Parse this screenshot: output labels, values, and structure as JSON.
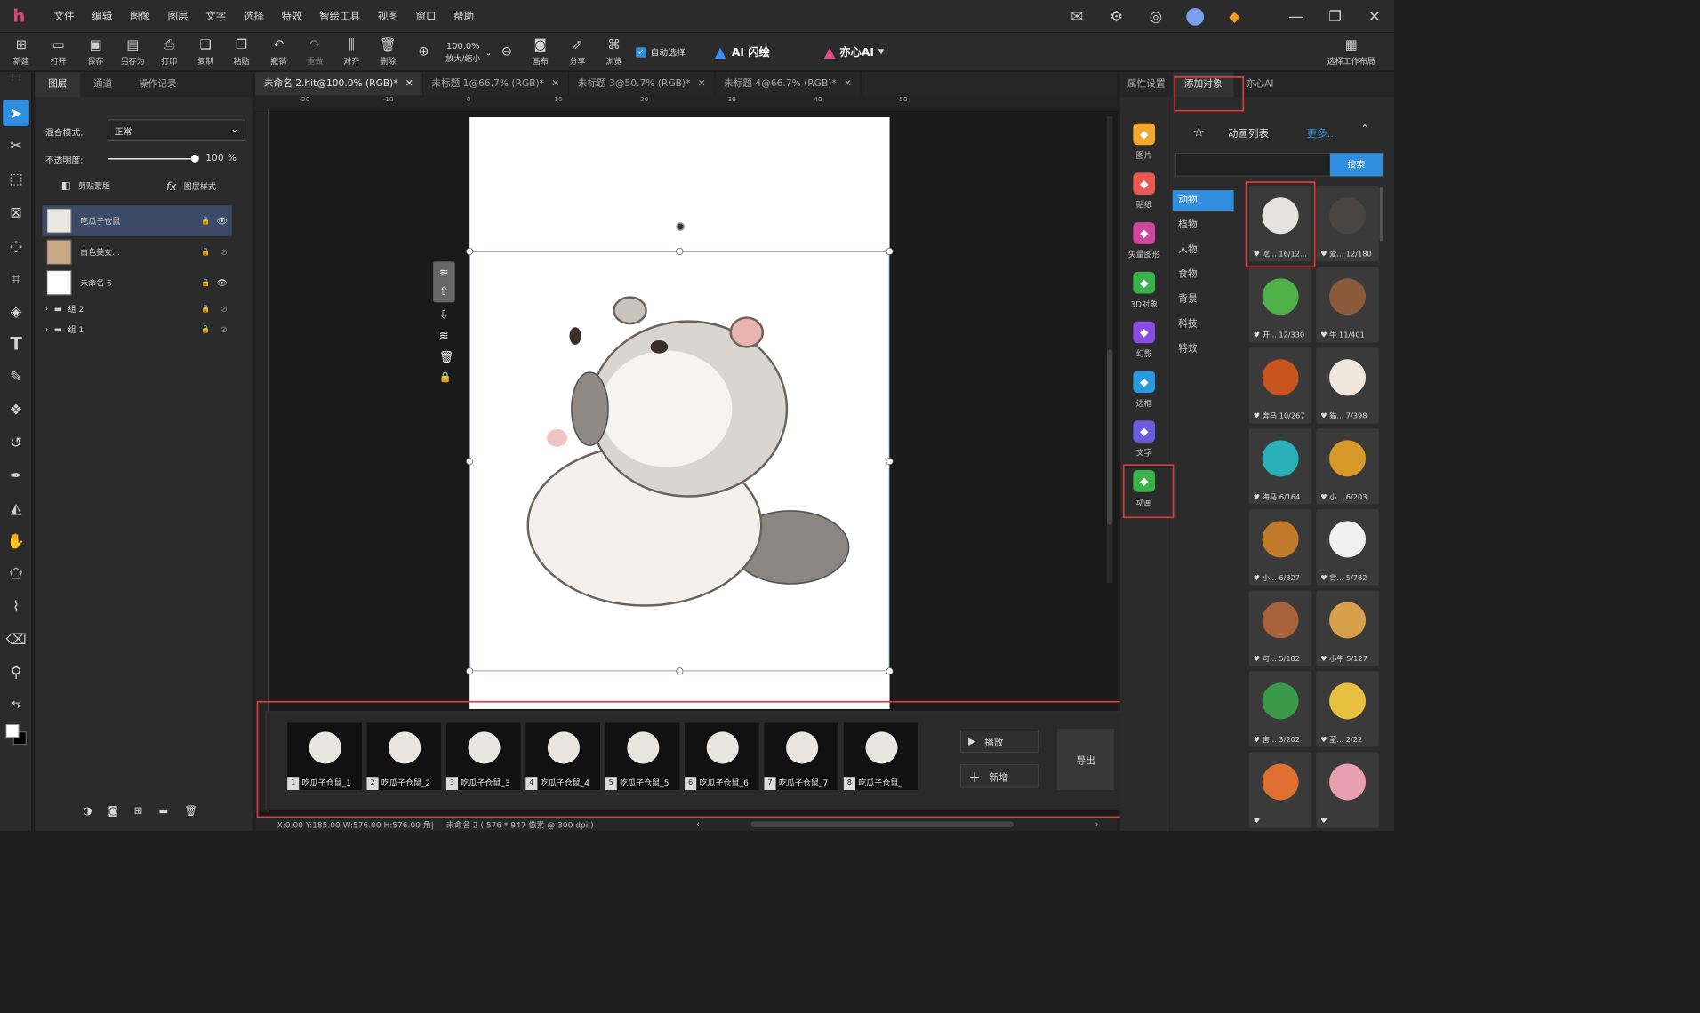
{
  "menubar": {
    "logo": "h",
    "items": [
      "文件",
      "编辑",
      "图像",
      "图层",
      "文字",
      "选择",
      "特效",
      "智绘工具",
      "视图",
      "窗口",
      "帮助"
    ]
  },
  "toolbar": {
    "new": "新建",
    "open": "打开",
    "save": "保存",
    "save_as": "另存为",
    "print": "打印",
    "copy": "复制",
    "paste": "粘贴",
    "undo": "撤销",
    "redo": "重做",
    "align": "对齐",
    "delete": "删除",
    "zoom_value": "100.0%",
    "zoom_label": "放大/缩小",
    "canvas": "画布",
    "share": "分享",
    "browse": "浏览",
    "auto_select": "自动选择",
    "ai_flash": "AI 闪绘",
    "yixin_ai": "亦心AI",
    "workspace": "选择工作布局"
  },
  "layers_panel": {
    "tabs": [
      "图层",
      "通道",
      "操作记录"
    ],
    "blend_label": "混合模式:",
    "blend_value": "正常",
    "opacity_label": "不透明度:",
    "opacity_value": "100",
    "opacity_unit": "%",
    "opacity_fraction": 1.0,
    "clip_mask": "剪贴蒙版",
    "layer_style": "图层样式",
    "layers": [
      {
        "name": "吃瓜子仓鼠",
        "selected": true
      },
      {
        "name": "白色美女...",
        "selected": false
      },
      {
        "name": "未命名 6",
        "selected": false
      }
    ],
    "groups": [
      "组 2",
      "组 1"
    ]
  },
  "doc_tabs": [
    {
      "label": "未命名 2.hit@100.0% (RGB)*",
      "active": true
    },
    {
      "label": "未标题 1@66.7% (RGB)*",
      "active": false
    },
    {
      "label": "未标题 3@50.7% (RGB)*",
      "active": false
    },
    {
      "label": "未标题 4@66.7% (RGB)*",
      "active": false
    }
  ],
  "ruler": {
    "h_ticks": [
      "-20",
      "-10",
      "0",
      "10",
      "20",
      "30",
      "40",
      "50"
    ]
  },
  "animation": {
    "frames": [
      {
        "n": "1",
        "label": "吃瓜子仓鼠_1"
      },
      {
        "n": "2",
        "label": "吃瓜子仓鼠_2"
      },
      {
        "n": "3",
        "label": "吃瓜子仓鼠_3"
      },
      {
        "n": "4",
        "label": "吃瓜子仓鼠_4"
      },
      {
        "n": "5",
        "label": "吃瓜子仓鼠_5"
      },
      {
        "n": "6",
        "label": "吃瓜子仓鼠_6"
      },
      {
        "n": "7",
        "label": "吃瓜子仓鼠_7"
      },
      {
        "n": "8",
        "label": "吃瓜子仓鼠_"
      }
    ],
    "play": "播放",
    "add": "新增",
    "export": "导出"
  },
  "status": {
    "text": "X:0.00 Y:185.00 W:576.00 H:576.00 角|",
    "doc": "未命名 2 ( 576 * 947 像素 @ 300 dpi )"
  },
  "right_panel": {
    "tabs": [
      "属性设置",
      "添加对象",
      "亦心AI"
    ],
    "categories": [
      {
        "label": "图片",
        "color": "#f0a830"
      },
      {
        "label": "贴纸",
        "color": "#e85a4f"
      },
      {
        "label": "矢量图形",
        "color": "#d045a0"
      },
      {
        "label": "3D对象",
        "color": "#3ab24a"
      },
      {
        "label": "幻影",
        "color": "#8a4be0"
      },
      {
        "label": "边框",
        "color": "#2a9ae0"
      },
      {
        "label": "文字",
        "color": "#6a5ae0"
      },
      {
        "label": "动画",
        "color": "#3ab24a"
      }
    ],
    "list_title": "动画列表",
    "more": "更多...",
    "search_button": "搜索",
    "search_value": "",
    "subcats": [
      "动物",
      "植物",
      "人物",
      "食物",
      "背景",
      "科技",
      "特效"
    ],
    "items": [
      {
        "label": "吃... 16/12...",
        "color": "#e6e3de"
      },
      {
        "label": "爱... 12/180",
        "color": "#4a4540"
      },
      {
        "label": "开... 12/330",
        "color": "#4fb04a"
      },
      {
        "label": "牛 11/401",
        "color": "#8a5a3a"
      },
      {
        "label": "奔马 10/267",
        "color": "#c8541e"
      },
      {
        "label": "猫... 7/398",
        "color": "#efe6dc"
      },
      {
        "label": "海马 6/164",
        "color": "#2ab0b8"
      },
      {
        "label": "小... 6/203",
        "color": "#d79a2a"
      },
      {
        "label": "小... 6/327",
        "color": "#c07a2a"
      },
      {
        "label": "背... 5/782",
        "color": "#f0f0f0"
      },
      {
        "label": "可... 5/182",
        "color": "#a8623a"
      },
      {
        "label": "小牛 5/127",
        "color": "#d8a04a"
      },
      {
        "label": "害... 3/202",
        "color": "#3a9a4a"
      },
      {
        "label": "萤... 2/22",
        "color": "#e8c040"
      },
      {
        "label": "",
        "color": "#e07030"
      },
      {
        "label": "",
        "color": "#e8a0b0"
      }
    ]
  }
}
